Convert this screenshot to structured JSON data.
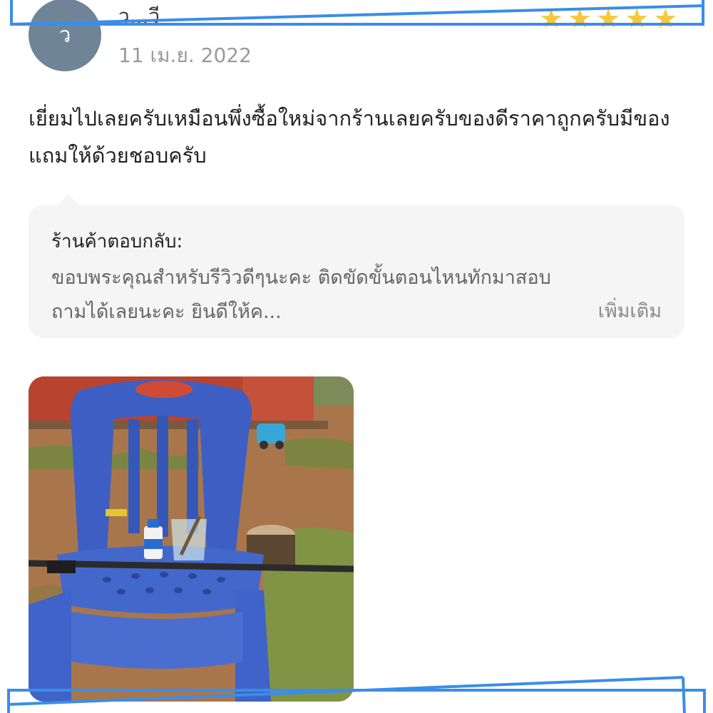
{
  "review": {
    "avatar_letter": "ว",
    "user_name": "ว...วี",
    "date": "11 เม.ย. 2022",
    "rating": 5,
    "text": "เยี่ยมไปเลยครับเหมือนพึ่งซื้อใหม่จากร้านเลยครับของดีราคาถูกครับมีของแถมให้ด้วยชอบครับ"
  },
  "reply": {
    "title": "ร้านค้าตอบกลับ:",
    "text": "ขอบพระคุณสำหรับรีวิวดีๆนะคะ ติดขัดขั้นตอนไหนทักมาสอบถามได้เลยนะคะ ยินดีให้ค...",
    "more_label": "เพิ่มเติม"
  },
  "colors": {
    "star": "#f7c83a",
    "avatar": "#6f8597",
    "frame": "#3b8de8"
  },
  "icons": {
    "star": "star-icon",
    "reply_pointer": "speech-pointer-icon"
  }
}
